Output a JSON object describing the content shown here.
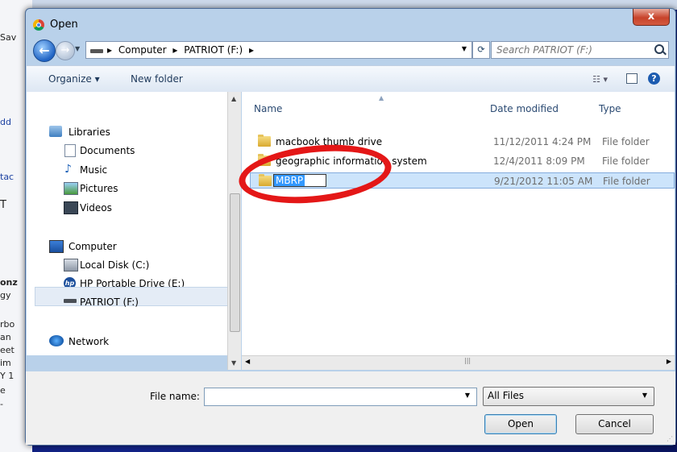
{
  "background": {
    "fragments": [
      "Sav",
      "dd",
      "tac",
      "T",
      "onz",
      "gy",
      "rbo",
      "an",
      "eet",
      "im",
      "Y 1",
      "e",
      "-"
    ]
  },
  "dialog": {
    "title": "Open",
    "close_label": "x"
  },
  "address": {
    "crumbs": [
      "Computer",
      "PATRIOT (F:)"
    ],
    "separator": "▸",
    "search_placeholder": "Search PATRIOT (F:)"
  },
  "toolbar": {
    "organize": "Organize ▾",
    "new_folder": "New folder",
    "view_label": "☷ ▾",
    "help": "?"
  },
  "nav": {
    "libraries": "Libraries",
    "documents": "Documents",
    "music": "Music",
    "pictures": "Pictures",
    "videos": "Videos",
    "computer": "Computer",
    "local_disk": "Local Disk (C:)",
    "hp_drive": "HP Portable Drive (E:)",
    "patriot": "PATRIOT (F:)",
    "network": "Network"
  },
  "columns": {
    "name": "Name",
    "date": "Date modified",
    "type": "Type"
  },
  "files": [
    {
      "name": "macbook thumb drive",
      "date": "11/12/2011 4:24 PM",
      "type": "File folder"
    },
    {
      "name": "geographic information system",
      "date": "12/4/2011 8:09 PM",
      "type": "File folder"
    },
    {
      "name": "MBRP",
      "date": "9/21/2012 11:05 AM",
      "type": "File folder"
    }
  ],
  "bottom": {
    "file_name_label": "File name:",
    "file_name_value": "",
    "filter": "All Files",
    "open": "Open",
    "cancel": "Cancel"
  },
  "colors": {
    "annotation": "#e41717",
    "selection": "#cce4fb"
  }
}
